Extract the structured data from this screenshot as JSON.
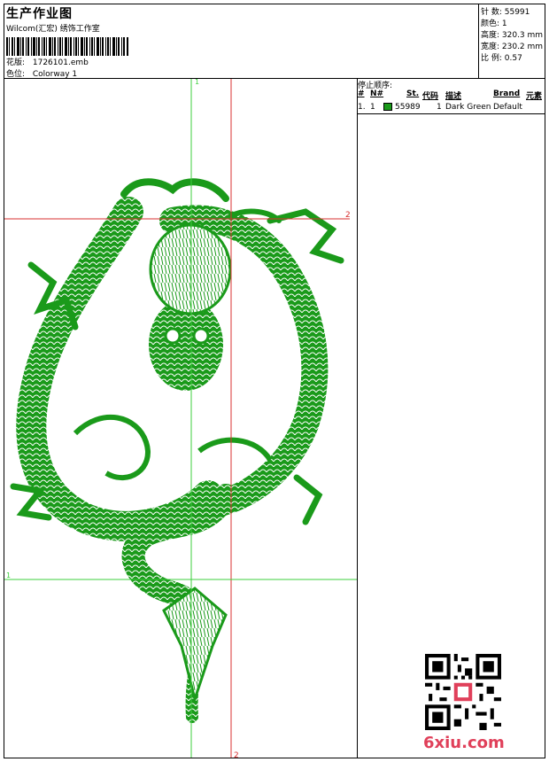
{
  "header": {
    "title": "生产作业图",
    "studio": "Wilcom(汇宏) 绣饰工作室",
    "file_label": "花版:",
    "file_value": "1726101.emb",
    "colorway_label": "色位:",
    "colorway_value": "Colorway 1"
  },
  "stats": {
    "stitches": "针 数: 55991",
    "colors": "颜色: 1",
    "height": "高度: 320.3 mm",
    "width": "宽度: 230.2 mm",
    "scale": "比 例: 0.57"
  },
  "stop_sequence": {
    "title": "停止顺序:",
    "columns": [
      "#",
      "N#",
      "St.",
      "代码",
      "描述",
      "Brand",
      "元素"
    ],
    "rows": [
      {
        "num": "1.",
        "needle": "1",
        "stitches": "55989",
        "code": "1",
        "description": "Dark Green",
        "brand": "Default",
        "swatch": "#1a9a1a"
      }
    ]
  },
  "guides": {
    "v_green": "1",
    "v_red": "2",
    "h_red": "2",
    "h_green": "1",
    "green": "#3ecf3e",
    "red": "#d83030"
  },
  "design": {
    "thread_color": "#1a9a1a",
    "motif": "dragon-embroidery"
  },
  "watermark": {
    "text": "6xiu.com",
    "color": "#e0405a"
  }
}
